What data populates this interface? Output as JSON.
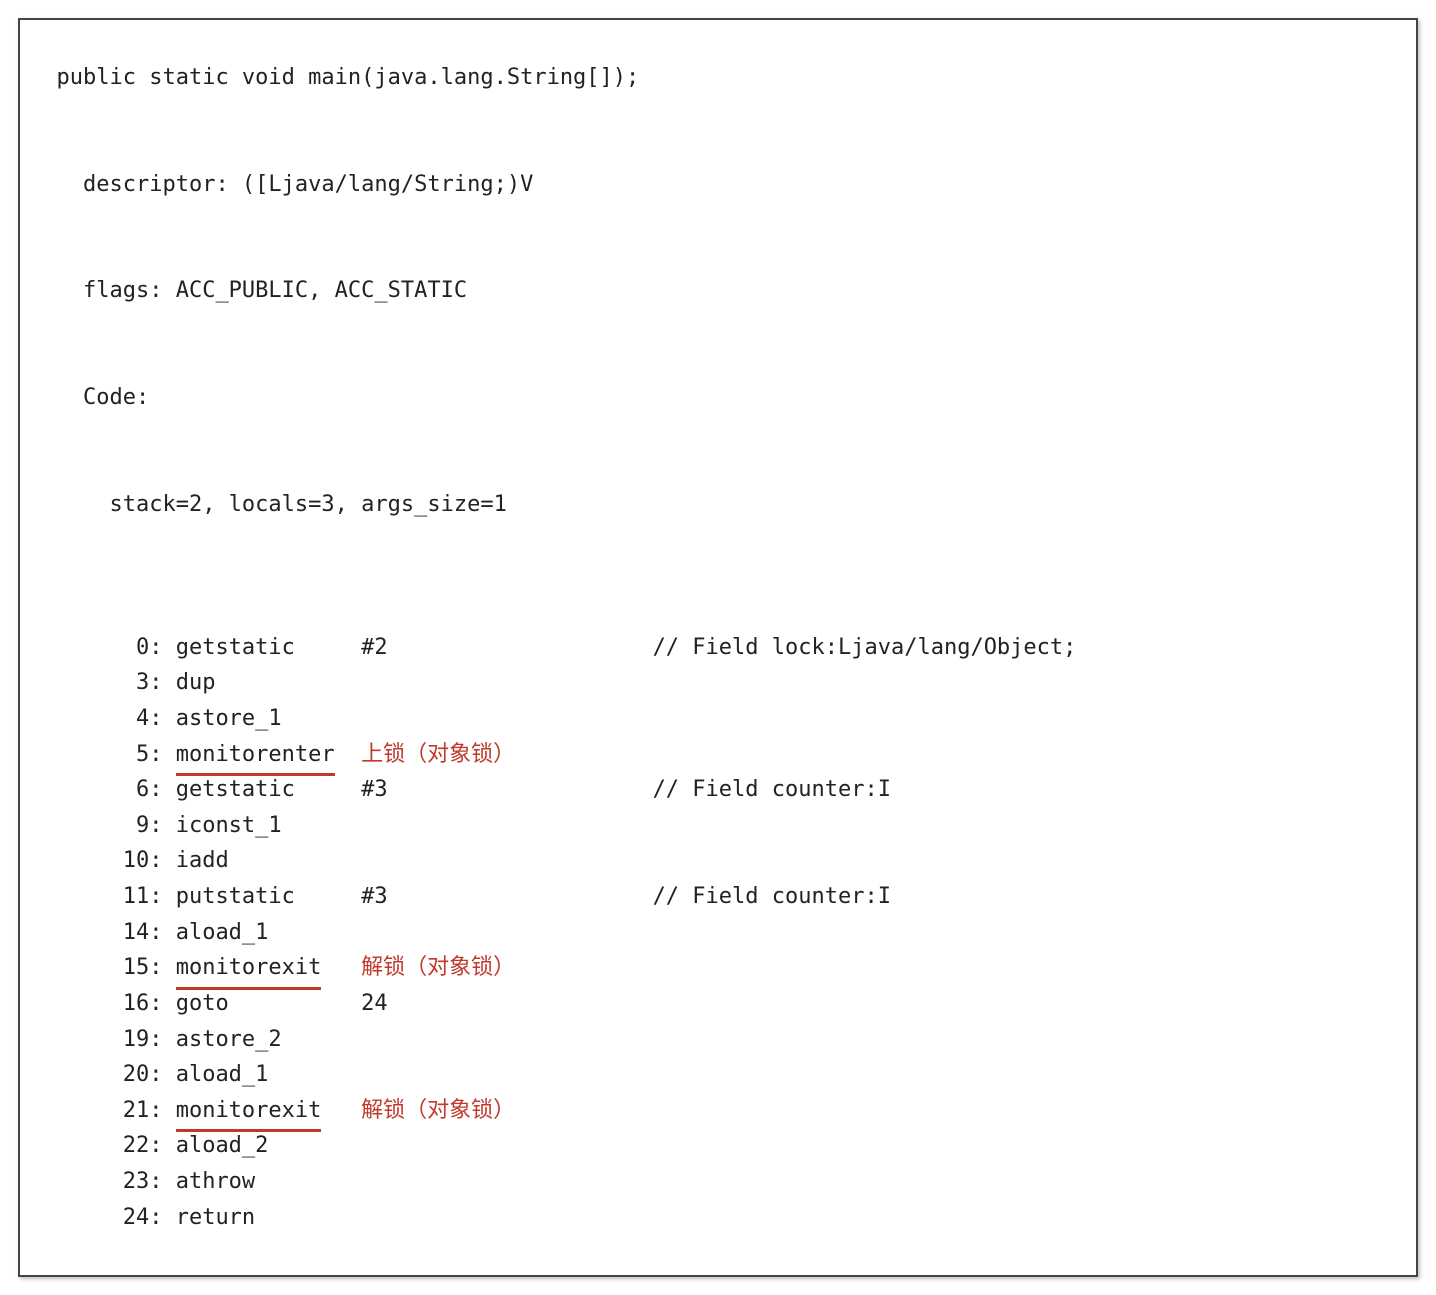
{
  "signature": "public static void main(java.lang.String[]);",
  "descriptor_line": "  descriptor: ([Ljava/lang/String;)V",
  "flags_line": "  flags: ACC_PUBLIC, ACC_STATIC",
  "code_label": "  Code:",
  "code_meta": "    stack=2, locals=3, args_size=1",
  "bytecode": [
    {
      "offset": " 0",
      "opcode": "getstatic",
      "arg": "#2",
      "annotation": "",
      "comment": "// Field lock:Ljava/lang/Object;",
      "underline": false
    },
    {
      "offset": " 3",
      "opcode": "dup",
      "arg": "",
      "annotation": "",
      "comment": "",
      "underline": false
    },
    {
      "offset": " 4",
      "opcode": "astore_1",
      "arg": "",
      "annotation": "",
      "comment": "",
      "underline": false
    },
    {
      "offset": " 5",
      "opcode": "monitorenter",
      "arg": "",
      "annotation": "上锁（对象锁）",
      "comment": "",
      "underline": true
    },
    {
      "offset": " 6",
      "opcode": "getstatic",
      "arg": "#3",
      "annotation": "",
      "comment": "// Field counter:I",
      "underline": false
    },
    {
      "offset": " 9",
      "opcode": "iconst_1",
      "arg": "",
      "annotation": "",
      "comment": "",
      "underline": false
    },
    {
      "offset": "10",
      "opcode": "iadd",
      "arg": "",
      "annotation": "",
      "comment": "",
      "underline": false
    },
    {
      "offset": "11",
      "opcode": "putstatic",
      "arg": "#3",
      "annotation": "",
      "comment": "// Field counter:I",
      "underline": false
    },
    {
      "offset": "14",
      "opcode": "aload_1",
      "arg": "",
      "annotation": "",
      "comment": "",
      "underline": false
    },
    {
      "offset": "15",
      "opcode": "monitorexit",
      "arg": "",
      "annotation": "解锁（对象锁）",
      "comment": "",
      "underline": true
    },
    {
      "offset": "16",
      "opcode": "goto",
      "arg": "24",
      "annotation": "",
      "comment": "",
      "underline": false
    },
    {
      "offset": "19",
      "opcode": "astore_2",
      "arg": "",
      "annotation": "",
      "comment": "",
      "underline": false
    },
    {
      "offset": "20",
      "opcode": "aload_1",
      "arg": "",
      "annotation": "",
      "comment": "",
      "underline": false
    },
    {
      "offset": "21",
      "opcode": "monitorexit",
      "arg": "",
      "annotation": "解锁（对象锁）",
      "comment": "",
      "underline": true
    },
    {
      "offset": "22",
      "opcode": "aload_2",
      "arg": "",
      "annotation": "",
      "comment": "",
      "underline": false
    },
    {
      "offset": "23",
      "opcode": "athrow",
      "arg": "",
      "annotation": "",
      "comment": "",
      "underline": false
    },
    {
      "offset": "24",
      "opcode": "return",
      "arg": "",
      "annotation": "",
      "comment": "",
      "underline": false
    }
  ],
  "columns": {
    "offset_width": 11,
    "opcode_width": 14,
    "arg_width": 22
  }
}
